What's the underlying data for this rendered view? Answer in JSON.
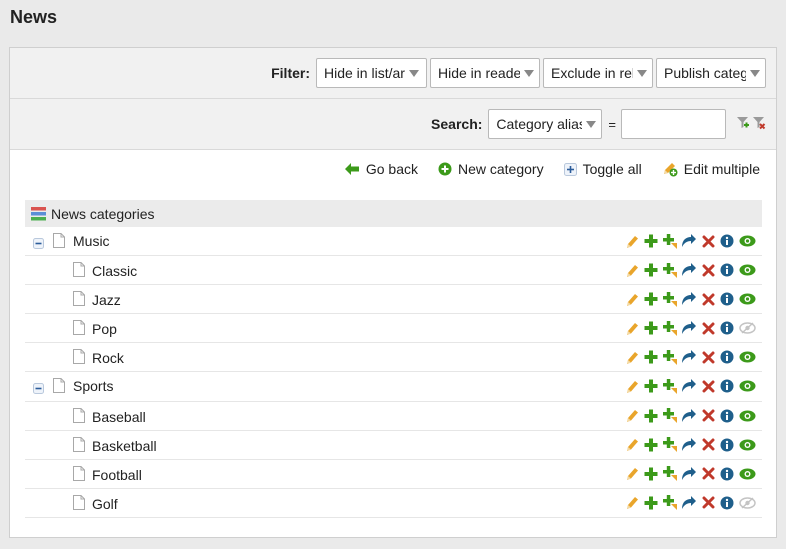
{
  "page": {
    "title": "News"
  },
  "filter": {
    "label": "Filter:",
    "selects": [
      {
        "name": "hide-in-list",
        "value": "Hide in list/ar",
        "width": 111
      },
      {
        "name": "hide-in-reader",
        "value": "Hide in reade",
        "width": 110
      },
      {
        "name": "exclude-in-related",
        "value": "Exclude in rel",
        "width": 110
      },
      {
        "name": "publish-category",
        "value": "Publish categ",
        "width": 110
      }
    ]
  },
  "search": {
    "label": "Search:",
    "field": "Category alias",
    "operator": "=",
    "value": ""
  },
  "actions": {
    "go_back": "Go back",
    "new_category": "New category",
    "toggle_all": "Toggle all",
    "edit_multiple": "Edit multiple"
  },
  "tree": {
    "header": "News categories",
    "rows": [
      {
        "label": "Music",
        "level": 0,
        "expanded": true,
        "published": true
      },
      {
        "label": "Classic",
        "level": 1,
        "published": true
      },
      {
        "label": "Jazz",
        "level": 1,
        "published": true
      },
      {
        "label": "Pop",
        "level": 1,
        "published": false
      },
      {
        "label": "Rock",
        "level": 1,
        "published": true
      },
      {
        "label": "Sports",
        "level": 0,
        "expanded": true,
        "published": true
      },
      {
        "label": "Baseball",
        "level": 1,
        "published": true
      },
      {
        "label": "Basketball",
        "level": 1,
        "published": true
      },
      {
        "label": "Football",
        "level": 1,
        "published": true
      },
      {
        "label": "Golf",
        "level": 1,
        "published": false
      }
    ]
  },
  "colors": {
    "green": "#3c9a1a",
    "red": "#c0392b",
    "blue": "#1f5f8b",
    "orange": "#e9a52b",
    "muted": "#c4c4c4"
  }
}
